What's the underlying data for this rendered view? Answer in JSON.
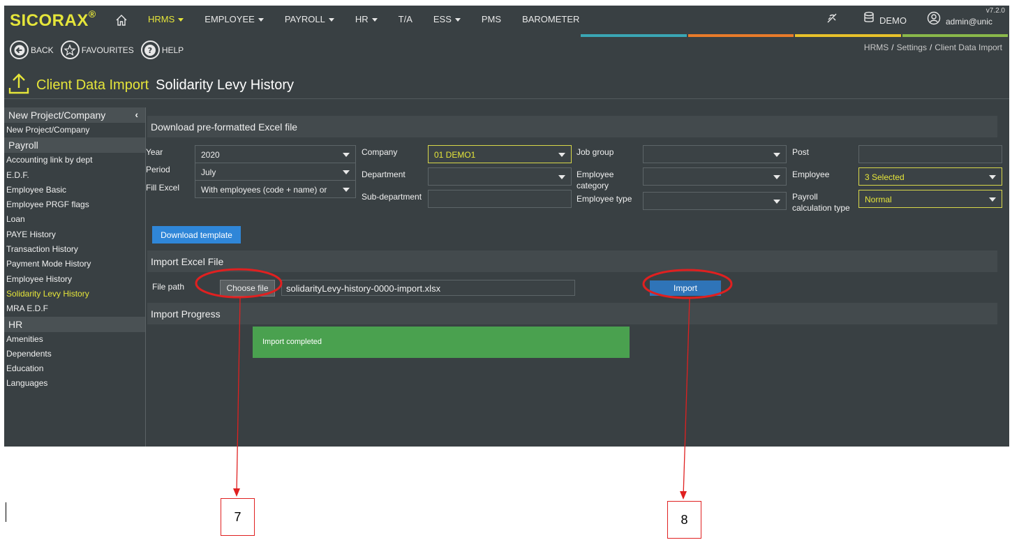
{
  "app": {
    "logo": "SICORAX",
    "logo_mark": "®",
    "version": "v7.2.0"
  },
  "nav": {
    "items": [
      {
        "label": "HRMS",
        "caret": true,
        "active": true
      },
      {
        "label": "EMPLOYEE",
        "caret": true
      },
      {
        "label": "PAYROLL",
        "caret": true
      },
      {
        "label": "HR",
        "caret": true
      },
      {
        "label": "T/A",
        "caret": false
      },
      {
        "label": "ESS",
        "caret": true
      },
      {
        "label": "PMS",
        "caret": false
      },
      {
        "label": "BAROMETER",
        "caret": false
      }
    ],
    "db_label": "DEMO",
    "user_label": "admin@unic",
    "color_bars": [
      "#3aa6b4",
      "#e87b2a",
      "#e8c12a",
      "#8ab84a"
    ]
  },
  "toolbar": {
    "back_label": "BACK",
    "favourites_label": "FAVOURITES",
    "help_label": "HELP"
  },
  "breadcrumb": {
    "items": [
      "HRMS",
      "Settings",
      "Client Data Import"
    ],
    "separator": "/"
  },
  "page": {
    "title": "Client Data Import",
    "subtitle": "Solidarity Levy History"
  },
  "sidebar": {
    "collapse_glyph": "‹",
    "groups": [
      {
        "heading": "New Project/Company",
        "items": [
          "New Project/Company"
        ]
      },
      {
        "heading": "Payroll",
        "items": [
          "Accounting link by dept",
          "E.D.F.",
          "Employee Basic",
          "Employee PRGF flags",
          "Loan",
          "PAYE History",
          "Transaction History",
          "Payment Mode History",
          "Employee History",
          "Solidarity Levy History",
          "MRA E.D.F"
        ]
      },
      {
        "heading": "HR",
        "items": [
          "Amenities",
          "Dependents",
          "Education",
          "Languages"
        ]
      }
    ],
    "active_item": "Solidarity Levy History"
  },
  "download_section": {
    "heading": "Download pre-formatted Excel file",
    "year_label": "Year",
    "year_value": "2020",
    "period_label": "Period",
    "period_value": "July",
    "fill_label": "Fill Excel",
    "fill_value": "With employees (code + name) or",
    "company_label": "Company",
    "company_value": "01 DEMO1",
    "department_label": "Department",
    "department_value": "",
    "subdepartment_label": "Sub-department",
    "subdepartment_value": "",
    "jobgroup_label": "Job group",
    "jobgroup_value": "",
    "empcat_label": "Employee category",
    "empcat_value": "",
    "emptype_label": "Employee type",
    "emptype_value": "",
    "post_label": "Post",
    "post_value": "",
    "employee_label": "Employee",
    "employee_value": "3 Selected",
    "calc_label": "Payroll calculation type",
    "calc_value": "Normal",
    "download_button": "Download template"
  },
  "import_section": {
    "heading": "Import Excel File",
    "file_path_label": "File path",
    "choose_button": "Choose file",
    "file_name": "solidarityLevy-history-0000-import.xlsx",
    "import_button": "Import"
  },
  "progress_section": {
    "heading": "Import Progress",
    "status_text": "Import completed",
    "progress_fraction": 1.0
  },
  "annotations": {
    "callout_7": "7",
    "callout_8": "8",
    "color": "#e02020"
  }
}
